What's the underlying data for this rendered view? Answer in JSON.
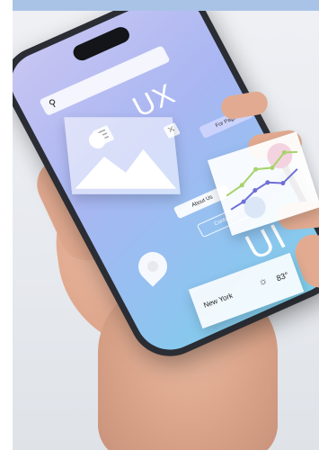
{
  "phone_screen": {
    "heading_ux": "UX",
    "heading_ui": "UI",
    "about_button": "About Us",
    "contact_button": "Contact Us",
    "tag_label": "For Page"
  },
  "weather_card": {
    "city": "New York",
    "temperature": "83°"
  },
  "icons": [
    "search-icon",
    "menu-icon",
    "close-icon",
    "image-icon",
    "line-chart-icon",
    "sun-icon",
    "location-pin-icon"
  ],
  "colors": {
    "screen_top": "#c8c5f2",
    "screen_bottom": "#7bd0e8",
    "band": "#a9c3e7"
  }
}
